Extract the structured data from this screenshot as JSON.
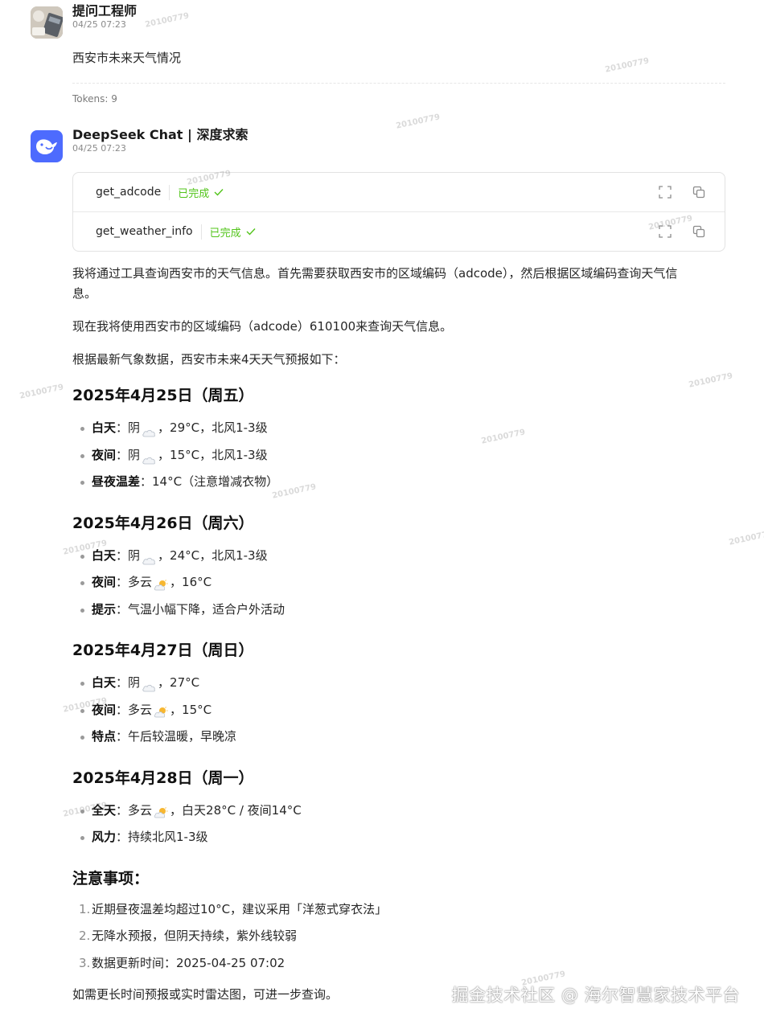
{
  "user_message": {
    "name": "提问工程师",
    "time": "04/25 07:23",
    "text": "西安市未来天气情况",
    "tokens": "Tokens: 9"
  },
  "bot_message": {
    "name": "DeepSeek Chat | 深度求索",
    "time": "04/25 07:23",
    "tools": [
      {
        "name": "get_adcode",
        "status": "已完成"
      },
      {
        "name": "get_weather_info",
        "status": "已完成"
      }
    ],
    "para1": "我将通过工具查询西安市的天气信息。首先需要获取西安市的区域编码（adcode），然后根据区域编码查询天气信",
    "para1_cont": "息。",
    "para2": "现在我将使用西安市的区域编码（adcode）610100来查询天气信息。",
    "para3": "根据最新气象数据，西安市未来4天天气预报如下：",
    "days": [
      {
        "title": "2025年4月25日（周五）",
        "items": [
          {
            "label": "白天",
            "pre": "：阴",
            "icon": "cloud",
            "post": "，29°C，北风1-3级"
          },
          {
            "label": "夜间",
            "pre": "：阴",
            "icon": "cloud",
            "post": "，15°C，北风1-3级"
          },
          {
            "label": "昼夜温差",
            "pre": "：14°C（注意增减衣物）",
            "icon": "",
            "post": ""
          }
        ]
      },
      {
        "title": "2025年4月26日（周六）",
        "items": [
          {
            "label": "白天",
            "pre": "：阴",
            "icon": "cloud",
            "post": "，24°C，北风1-3级"
          },
          {
            "label": "夜间",
            "pre": "：多云",
            "icon": "sun-cloud",
            "post": "，16°C"
          },
          {
            "label": "提示",
            "pre": "：气温小幅下降，适合户外活动",
            "icon": "",
            "post": ""
          }
        ]
      },
      {
        "title": "2025年4月27日（周日）",
        "items": [
          {
            "label": "白天",
            "pre": "：阴",
            "icon": "cloud",
            "post": "，27°C"
          },
          {
            "label": "夜间",
            "pre": "：多云",
            "icon": "sun-cloud",
            "post": "，15°C"
          },
          {
            "label": "特点",
            "pre": "：午后较温暖，早晚凉",
            "icon": "",
            "post": ""
          }
        ]
      },
      {
        "title": "2025年4月28日（周一）",
        "items": [
          {
            "label": "全天",
            "pre": "：多云",
            "icon": "sun-cloud",
            "post": "，白天28°C / 夜间14°C"
          },
          {
            "label": "风力",
            "pre": "：持续北风1-3级",
            "icon": "",
            "post": ""
          }
        ]
      }
    ],
    "notes_title": "注意事项：",
    "notes": [
      {
        "n": "1.",
        "text": "近期昼夜温差均超过10°C，建议采用「洋葱式穿衣法」"
      },
      {
        "n": "2.",
        "text": "无降水预报，但阴天持续，紫外线较弱"
      },
      {
        "n": "3.",
        "text": "数据更新时间：2025-04-25 07:02"
      }
    ],
    "closing": "如需更长时间预报或实时雷达图，可进一步查询。"
  },
  "watermark": {
    "code": "20100779",
    "footer": "掘金技术社区 @ 海尔智慧家技术平台"
  },
  "colors": {
    "accent": "#4d6bfe",
    "success": "#52c41a"
  }
}
